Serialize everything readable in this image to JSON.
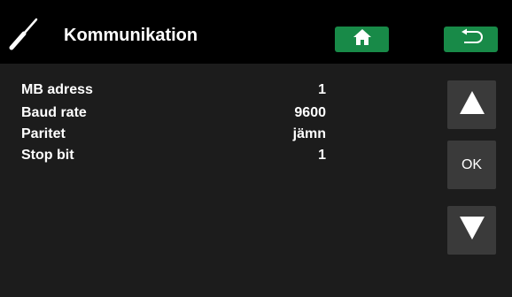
{
  "header": {
    "icon": "screwdriver-icon",
    "title": "Kommunikation",
    "home_icon": "home-icon",
    "back_icon": "back-arrow-icon"
  },
  "settings": [
    {
      "label": "MB adress",
      "value": "1"
    },
    {
      "label": "Baud rate",
      "value": "9600"
    },
    {
      "label": "Paritet",
      "value": "jämn"
    },
    {
      "label": "Stop bit",
      "value": "1"
    }
  ],
  "side_buttons": {
    "up_icon": "triangle-up-icon",
    "ok_label": "OK",
    "down_icon": "triangle-down-icon"
  },
  "colors": {
    "accent_green": "#188a48",
    "button_gray": "#3a3a3a",
    "panel": "#1c1c1c",
    "background": "#000000"
  }
}
